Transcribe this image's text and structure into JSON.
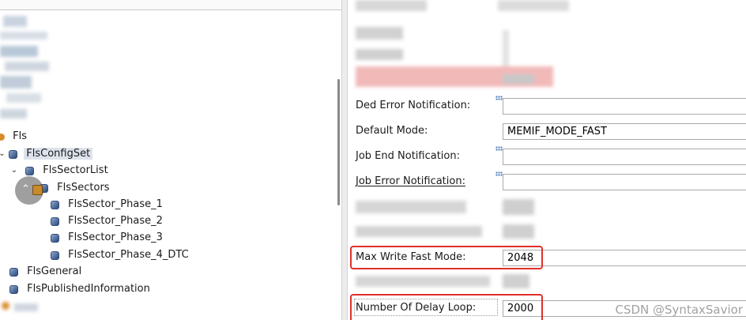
{
  "tree": {
    "items": [
      {
        "label": "Fls",
        "level": 0
      },
      {
        "label": "FlsConfigSet",
        "level": 0,
        "selected": true
      },
      {
        "label": "FlsSectorList",
        "level": 1
      },
      {
        "label": "FlsSectors",
        "level": 2
      },
      {
        "label": "FlsSector_Phase_1",
        "level": 3
      },
      {
        "label": "FlsSector_Phase_2",
        "level": 3
      },
      {
        "label": "FlsSector_Phase_3",
        "level": 3
      },
      {
        "label": "FlsSector_Phase_4_DTC",
        "level": 3
      },
      {
        "label": "FlsGeneral",
        "level": 0
      },
      {
        "label": "FlsPublishedInformation",
        "level": 0
      }
    ]
  },
  "form": {
    "ded_error_notification": {
      "label": "Ded Error Notification:",
      "value": ""
    },
    "default_mode": {
      "label": "Default Mode:",
      "value": "MEMIF_MODE_FAST"
    },
    "job_end_notification": {
      "label": "Job End Notification:",
      "value": ""
    },
    "job_error_notification": {
      "label": "Job Error Notification:",
      "value": ""
    },
    "max_write_fast_mode": {
      "label": "Max Write Fast Mode:",
      "value": "2048"
    },
    "number_of_delay_loop": {
      "label": "Number Of Delay Loop:",
      "value": "2000"
    }
  },
  "watermark": "CSDN @SyntaxSavior",
  "colors": {
    "highlight": "#e0302a",
    "selection": "#dde3ec",
    "node_icon": "#4f6c9c",
    "field_border": "#a9a9a9"
  },
  "icons": {
    "tree_node": "config-container-icon",
    "expand": "chevron-down-icon",
    "field_marker": "dotted-grid-icon"
  }
}
